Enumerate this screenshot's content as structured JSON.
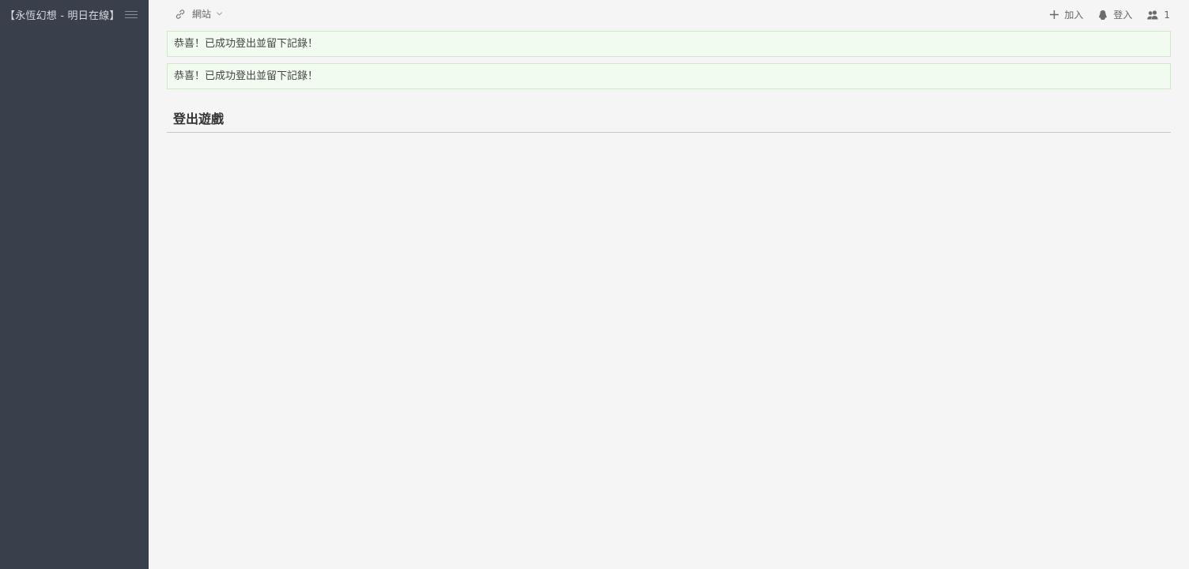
{
  "sidebar": {
    "brand": "【永恆幻想 - 明日在線】"
  },
  "topbar": {
    "site_menu_label": "網站",
    "join_label": "加入",
    "login_label": "登入",
    "online_count": "1"
  },
  "alerts": [
    "恭喜！已成功登出並留下記錄！",
    "恭喜！已成功登出並留下記錄！"
  ],
  "main": {
    "section_title": "登出遊戲"
  },
  "colors": {
    "sidebar_bg": "#393f4b",
    "page_bg": "#f5f5f5",
    "alert_bg": "#f1fbef",
    "alert_border": "#cfe8c8"
  }
}
